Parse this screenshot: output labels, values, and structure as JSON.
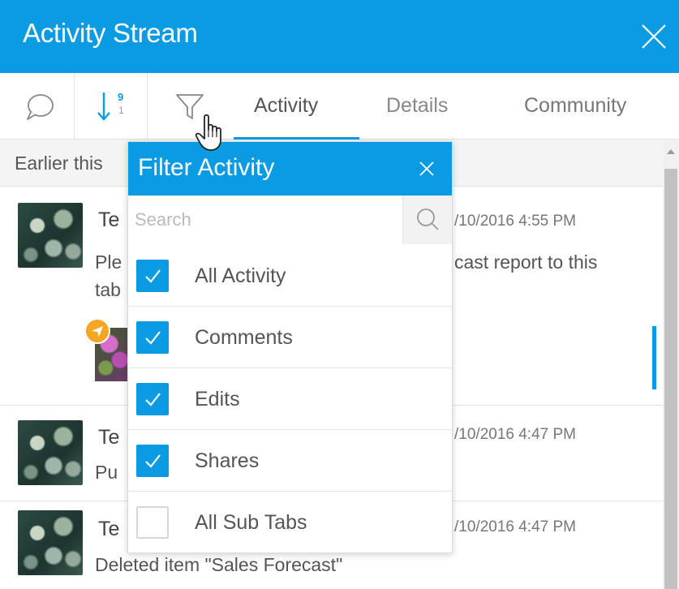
{
  "header": {
    "title": "Activity Stream"
  },
  "tabs": [
    {
      "label": "Activity",
      "active": true
    },
    {
      "label": "Details",
      "active": false
    },
    {
      "label": "Community",
      "active": false
    }
  ],
  "sort_icon": {
    "top": "9",
    "bottom": "1"
  },
  "stream": {
    "section_label": "Earlier this",
    "items": [
      {
        "name": "Te",
        "time": "/10/2016 4:55 PM",
        "text_line1_left": "Ple",
        "text_line1_right": "cast report to this",
        "text_line2": "tab"
      },
      {
        "name": "Te",
        "time": "/10/2016 4:47 PM",
        "text_left": "Pu"
      },
      {
        "name": "Te",
        "time": "/10/2016 4:47 PM",
        "text": "Deleted item \"Sales Forecast\""
      }
    ]
  },
  "filter_popup": {
    "title": "Filter Activity",
    "search_placeholder": "Search",
    "options": [
      {
        "label": "All Activity",
        "checked": true
      },
      {
        "label": "Comments",
        "checked": true
      },
      {
        "label": "Edits",
        "checked": true
      },
      {
        "label": "Shares",
        "checked": true
      },
      {
        "label": "All Sub Tabs",
        "checked": false
      }
    ]
  },
  "colors": {
    "accent": "#0a9be3",
    "share_badge": "#f5a623"
  },
  "icons": [
    "close-icon",
    "comment-icon",
    "sort-icon",
    "filter-icon",
    "search-icon",
    "check-icon",
    "hand-cursor-icon",
    "share-icon"
  ]
}
